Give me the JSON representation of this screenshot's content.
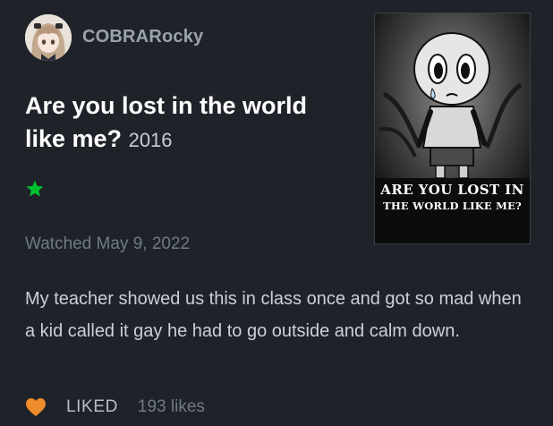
{
  "user": {
    "username": "COBRARocky",
    "avatar_icon": "anime-girl-avatar-icon"
  },
  "film": {
    "title": "Are you lost in the world like me?",
    "year": "2016",
    "poster": {
      "line1": "ARE YOU LOST IN",
      "line2": "THE WORLD LIKE ME?"
    }
  },
  "rating": {
    "stars": 1,
    "max_stars": 5,
    "star_color": "#00c030"
  },
  "watched": "Watched May 9, 2022",
  "review": "My teacher showed us this in class once and got so mad when a kid called it gay he had to go outside and calm down.",
  "footer": {
    "heart_icon": "heart-icon",
    "heart_color": "#ee8b2a",
    "liked_label": "LIKED",
    "likes_count": "193 likes"
  }
}
